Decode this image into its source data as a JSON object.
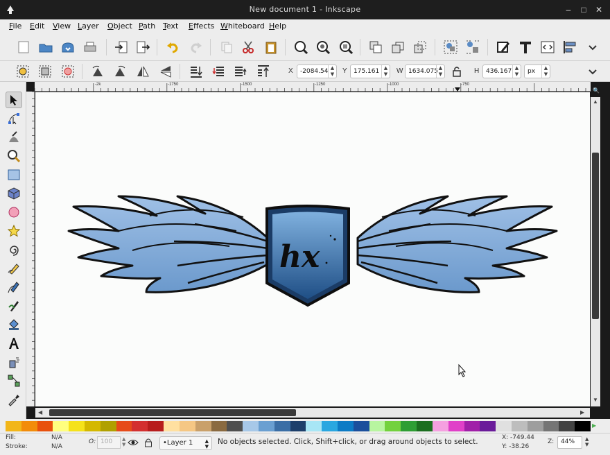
{
  "window": {
    "title": "New document 1 - Inkscape",
    "minimize": "–",
    "maximize": "□",
    "close": "✕"
  },
  "menu": [
    "File",
    "Edit",
    "View",
    "Layer",
    "Object",
    "Path",
    "Text",
    "Effects",
    "Whiteboard",
    "Help"
  ],
  "commands": {
    "icons": [
      "new-icon",
      "open-icon",
      "save-icon",
      "print-icon",
      "import-icon",
      "export-icon",
      "undo-icon",
      "redo-icon",
      "copy-icon",
      "cut-icon",
      "paste-icon",
      "zoom-selection-icon",
      "zoom-drawing-icon",
      "zoom-page-icon",
      "duplicate-icon",
      "clone-icon",
      "unlink-clone-icon",
      "group-icon",
      "ungroup-icon",
      "fill-stroke-icon",
      "text-font-icon",
      "xml-editor-icon",
      "align-distribute-icon",
      "more-chevron-icon"
    ]
  },
  "controls": {
    "x_label": "X",
    "x_value": "-2084.54",
    "y_label": "Y",
    "y_value": "175.161",
    "w_label": "W",
    "w_value": "1634.075",
    "h_label": "H",
    "h_value": "436.167",
    "unit": "px"
  },
  "ruler": {
    "h_ticks": [
      "-2k",
      "-1750",
      "-1500",
      "-1250",
      "-1000",
      "-750"
    ],
    "v_ticks": [
      "5",
      "0",
      "5",
      "0"
    ]
  },
  "palette": {
    "colors": [
      "#f2b619",
      "#f28c0a",
      "#e8500c",
      "#ffff7f",
      "#f5e21b",
      "#d4b800",
      "#b0a000",
      "#e64a19",
      "#d32f2f",
      "#b71c1c",
      "#ffe0a0",
      "#f5c784",
      "#c9a06a",
      "#8a6a40",
      "#4f4f4f",
      "#a7c8e8",
      "#6a9fd1",
      "#3b6ea5",
      "#1d3f6b",
      "#a8e6f5",
      "#2aa7e0",
      "#0d7bc5",
      "#1b4f9c",
      "#b8f5a0",
      "#73d13d",
      "#2e9e34",
      "#1b6e1f",
      "#f5a0e0",
      "#e040c8",
      "#a020a8",
      "#6a1b9a",
      "#e0e0e0",
      "#bdbdbd",
      "#9e9e9e",
      "#757575",
      "#424242",
      "#000000"
    ]
  },
  "status": {
    "fill_label": "Fill:",
    "fill_value": "N/A",
    "stroke_label": "Stroke:",
    "stroke_value": "N/A",
    "opacity_label": "O:",
    "opacity_value": "100",
    "layer": "•Layer 1",
    "message": "No objects selected. Click, Shift+click, or drag around objects to select.",
    "x_coord": "X: -749.44",
    "y_coord": "Y: -38.26",
    "zoom_label": "Z:",
    "zoom_value": "44%"
  },
  "artwork": {
    "logo_text": "hx",
    "colors": {
      "wing_light": "#a9c6e6",
      "wing_mid": "#7aa6d4",
      "shield_dark": "#1f4f86",
      "shield_light": "#6f9fd0",
      "outline": "#111111"
    }
  }
}
